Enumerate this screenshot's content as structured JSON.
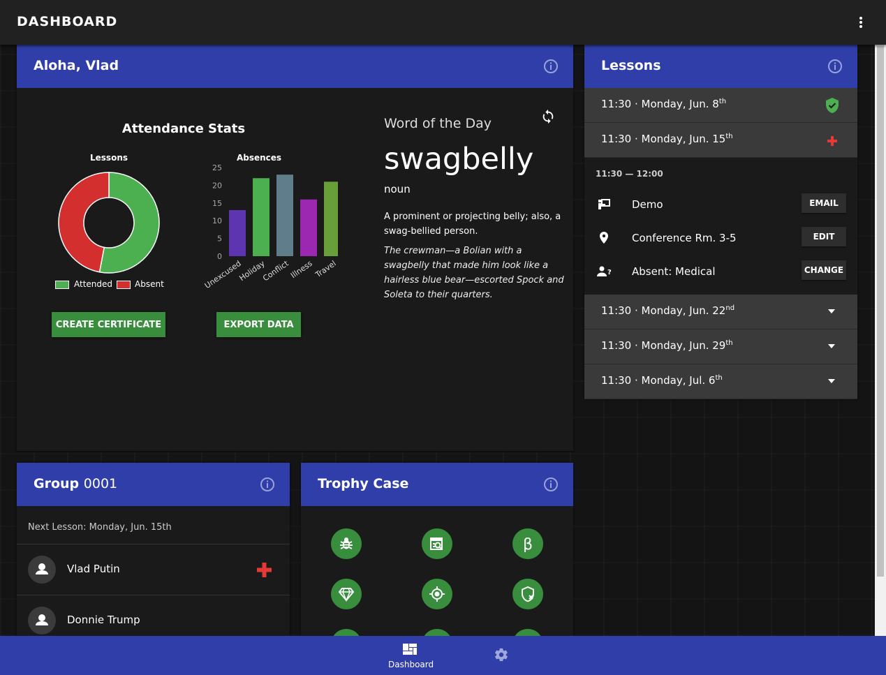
{
  "appbar": {
    "title": "DASHBOARD",
    "menu_icon": "more-vert-icon"
  },
  "welcome": {
    "title": "Aloha, Vlad",
    "attendance_title": "Attendance Stats",
    "buttons": {
      "certificate": "CREATE CERTIFICATE",
      "export": "EXPORT DATA"
    }
  },
  "chart_data": [
    {
      "type": "pie",
      "title": "Lessons",
      "categories": [
        "Attended",
        "Absent"
      ],
      "values": [
        53,
        47
      ],
      "colors": [
        "#4caf50",
        "#d32f2f"
      ],
      "legend": "bottom"
    },
    {
      "type": "bar",
      "title": "Absences",
      "categories": [
        "Unexcused",
        "Holiday",
        "Conflict",
        "Illness",
        "Travel"
      ],
      "values": [
        13,
        22,
        23,
        16,
        21
      ],
      "colors": [
        "#5e35b1",
        "#4caf50",
        "#607d8b",
        "#9c27b0",
        "#689f38"
      ],
      "ylim": [
        0,
        25
      ],
      "yticks": [
        0,
        5,
        10,
        15,
        20,
        25
      ]
    }
  ],
  "wotd": {
    "label": "Word of the Day",
    "word": "swagbelly",
    "pos": "noun",
    "definition": "A prominent or projecting belly; also, a swag-bellied person.",
    "example": "The crewman—a Bolian with a swagbelly that made him look like a hairless blue bear—escorted Spock and Soleta to their quarters.",
    "refresh_icon": "refresh-icon"
  },
  "lessons": {
    "title": "Lessons",
    "items": [
      {
        "time": "11:30 · Monday, Jun. 8",
        "suffix": "th",
        "status": "shield-check-icon"
      },
      {
        "time": "11:30 · Monday, Jun. 15",
        "suffix": "th",
        "status": "red-cross-icon"
      },
      {
        "time": "11:30 · Monday, Jun. 22",
        "suffix": "nd",
        "status": "chevron-down-icon"
      },
      {
        "time": "11:30 · Monday, Jun. 29",
        "suffix": "th",
        "status": "chevron-down-icon"
      },
      {
        "time": "11:30 · Monday, Jul. 6",
        "suffix": "th",
        "status": "chevron-down-icon"
      }
    ],
    "detail": {
      "range": "11:30 — 12:00",
      "rows": [
        {
          "text": "Demo",
          "button": "EMAIL",
          "icon": "presenter-icon"
        },
        {
          "text": "Conference Rm. 3-5",
          "button": "EDIT",
          "icon": "location-pin-icon"
        },
        {
          "text": "Absent: Medical",
          "button": "CHANGE",
          "icon": "person-question-icon"
        }
      ]
    }
  },
  "group": {
    "title_bold": "Group",
    "title_light": "0001",
    "next_lesson": "Next Lesson: Monday, Jun. 15th",
    "members": [
      {
        "name": "Vlad Putin",
        "status": "red-cross-icon"
      },
      {
        "name": "Donnie Trump",
        "status": ""
      }
    ]
  },
  "trophy": {
    "title": "Trophy Case",
    "icons": [
      "bug-icon",
      "search-report-icon",
      "beta-icon",
      "diamond-icon",
      "target-icon",
      "shield-off-icon"
    ]
  },
  "bottom_nav": {
    "dashboard": "Dashboard",
    "settings_icon": "gear-icon"
  }
}
